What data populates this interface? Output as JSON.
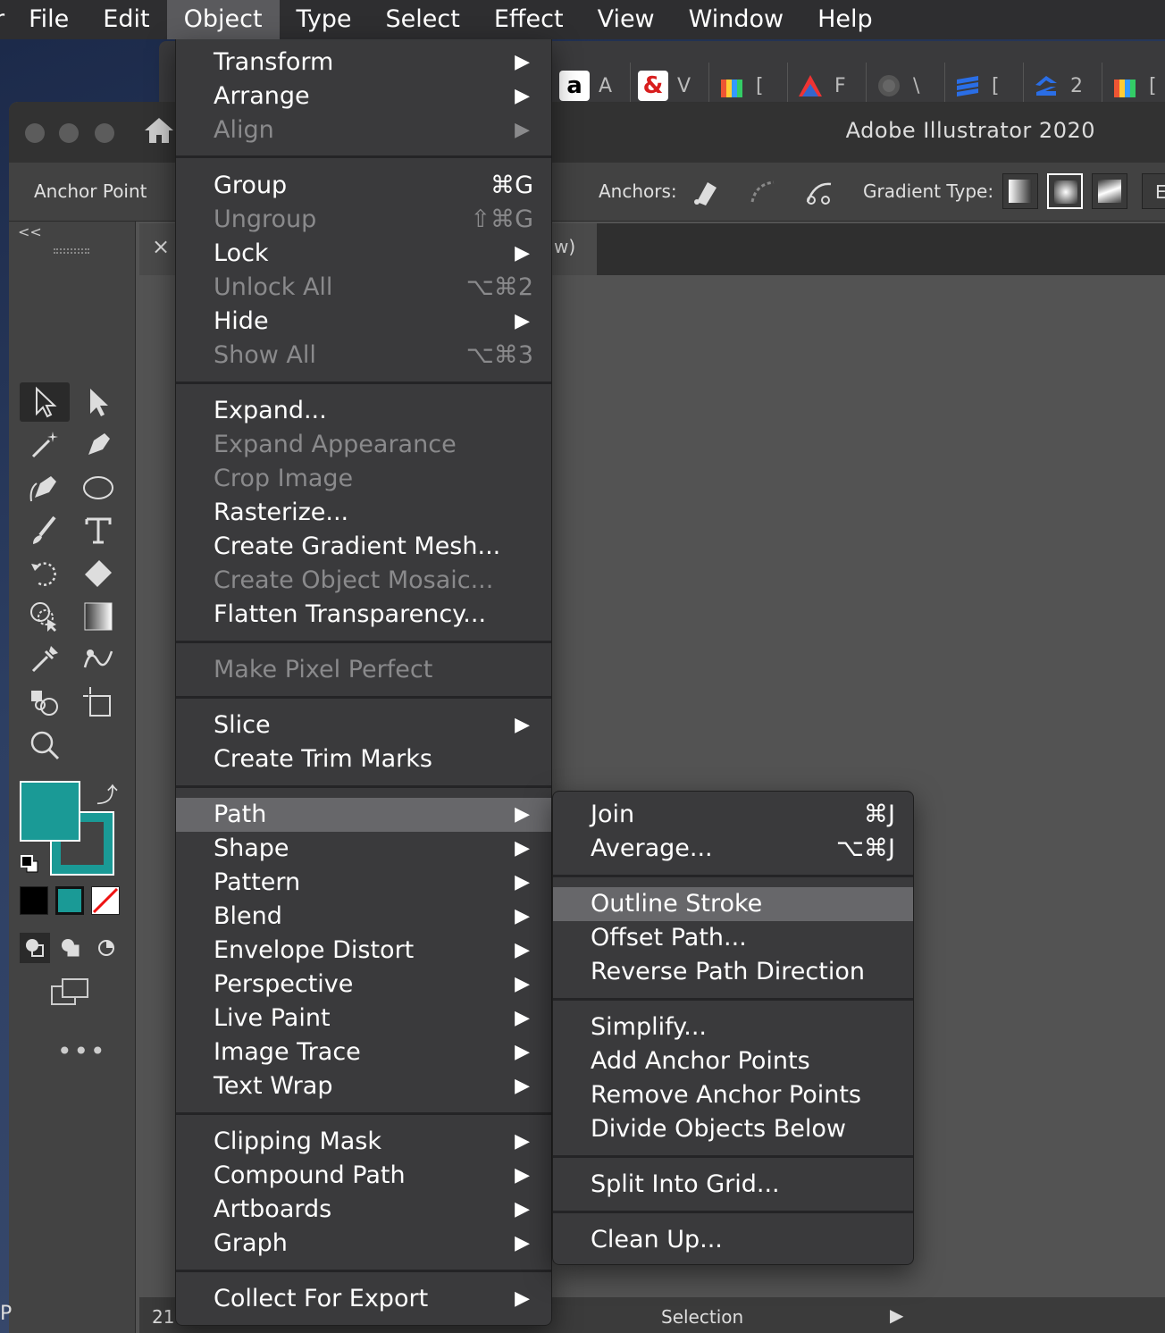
{
  "menubar": {
    "app_fragment": "r",
    "items": [
      {
        "label": "File"
      },
      {
        "label": "Edit"
      },
      {
        "label": "Object"
      },
      {
        "label": "Type"
      },
      {
        "label": "Select"
      },
      {
        "label": "Effect"
      },
      {
        "label": "View"
      },
      {
        "label": "Window"
      },
      {
        "label": "Help"
      }
    ],
    "active": "Object"
  },
  "bookmarks": [
    {
      "icon": "amazon-icon",
      "letter": "A"
    },
    {
      "icon": "ampersand-icon",
      "letter": "V"
    },
    {
      "icon": "gift-icon",
      "letter": "["
    },
    {
      "icon": "triangle-logo-icon",
      "letter": "F"
    },
    {
      "icon": "globe-icon",
      "letter": "\\"
    },
    {
      "icon": "stack-logo-icon",
      "letter": "["
    },
    {
      "icon": "z-logo-icon",
      "letter": "2"
    },
    {
      "icon": "gift-icon",
      "letter": "["
    }
  ],
  "window": {
    "title": "Adobe Illustrator 2020"
  },
  "control_bar": {
    "tool_label": "Anchor Point",
    "anchors_label": "Anchors:",
    "gradient_type_label": "Gradient Type:",
    "overflow_letter": "E"
  },
  "document_tab": {
    "title_fragment": "w)",
    "close": "×"
  },
  "toolbar": {
    "collapse": "<<",
    "fill_color": "#1a9a96",
    "stroke_color": "#1a9a96",
    "more": "•••"
  },
  "status": {
    "zoom_fragment": "21",
    "tool": "Selection",
    "arrow": "▶",
    "left_edge": "P"
  },
  "object_menu": {
    "items": [
      {
        "label": "Transform",
        "submenu": true
      },
      {
        "label": "Arrange",
        "submenu": true
      },
      {
        "label": "Align",
        "submenu": true,
        "disabled": true
      },
      {
        "label": "Group",
        "shortcut": "⌘G"
      },
      {
        "label": "Ungroup",
        "shortcut": "⇧⌘G",
        "disabled": true
      },
      {
        "label": "Lock",
        "submenu": true
      },
      {
        "label": "Unlock All",
        "shortcut": "⌥⌘2",
        "disabled": true
      },
      {
        "label": "Hide",
        "submenu": true
      },
      {
        "label": "Show All",
        "shortcut": "⌥⌘3",
        "disabled": true
      },
      {
        "label": "Expand..."
      },
      {
        "label": "Expand Appearance",
        "disabled": true
      },
      {
        "label": "Crop Image",
        "disabled": true
      },
      {
        "label": "Rasterize..."
      },
      {
        "label": "Create Gradient Mesh..."
      },
      {
        "label": "Create Object Mosaic...",
        "disabled": true
      },
      {
        "label": "Flatten Transparency..."
      },
      {
        "label": "Make Pixel Perfect",
        "disabled": true
      },
      {
        "label": "Slice",
        "submenu": true
      },
      {
        "label": "Create Trim Marks"
      },
      {
        "label": "Path",
        "submenu": true,
        "highlighted": true
      },
      {
        "label": "Shape",
        "submenu": true
      },
      {
        "label": "Pattern",
        "submenu": true
      },
      {
        "label": "Blend",
        "submenu": true
      },
      {
        "label": "Envelope Distort",
        "submenu": true
      },
      {
        "label": "Perspective",
        "submenu": true
      },
      {
        "label": "Live Paint",
        "submenu": true
      },
      {
        "label": "Image Trace",
        "submenu": true
      },
      {
        "label": "Text Wrap",
        "submenu": true
      },
      {
        "label": "Clipping Mask",
        "submenu": true
      },
      {
        "label": "Compound Path",
        "submenu": true
      },
      {
        "label": "Artboards",
        "submenu": true
      },
      {
        "label": "Graph",
        "submenu": true
      },
      {
        "label": "Collect For Export",
        "submenu": true
      }
    ],
    "submenu_arrow": "▶"
  },
  "path_menu": {
    "items": [
      {
        "label": "Join",
        "shortcut": "⌘J"
      },
      {
        "label": "Average...",
        "shortcut": "⌥⌘J"
      },
      {
        "label": "Outline Stroke",
        "highlighted": true
      },
      {
        "label": "Offset Path..."
      },
      {
        "label": "Reverse Path Direction"
      },
      {
        "label": "Simplify..."
      },
      {
        "label": "Add Anchor Points"
      },
      {
        "label": "Remove Anchor Points"
      },
      {
        "label": "Divide Objects Below"
      },
      {
        "label": "Split Into Grid..."
      },
      {
        "label": "Clean Up..."
      }
    ]
  }
}
